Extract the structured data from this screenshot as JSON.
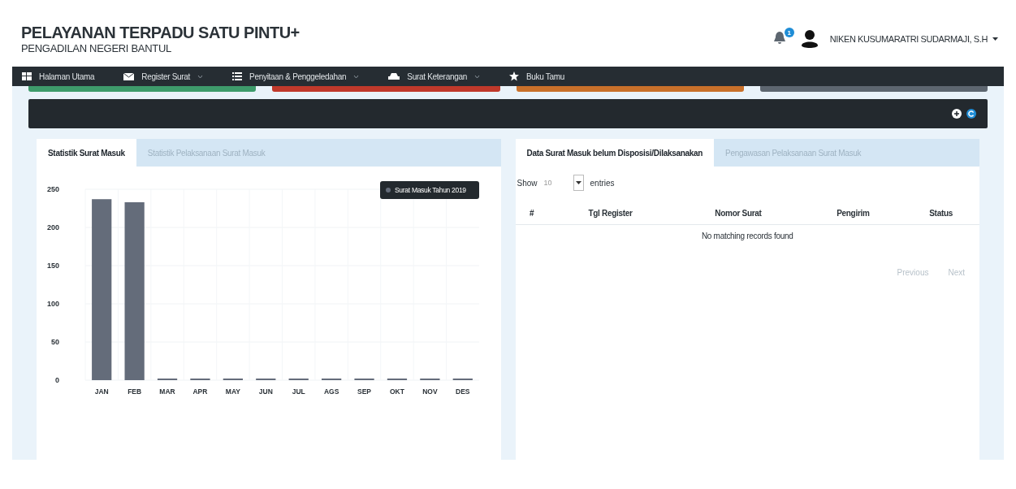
{
  "header": {
    "title": "PELAYANAN TERPADU SATU PINTU+",
    "subtitle": "PENGADILAN NEGERI BANTUL",
    "notification_count": "1",
    "user_name": "NIKEN KUSUMARATRI SUDARMAJI, S.H"
  },
  "nav": [
    {
      "label": "Halaman Utama",
      "dropdown": false
    },
    {
      "label": "Register Surat",
      "dropdown": true
    },
    {
      "label": "Penyitaan & Penggeledahan",
      "dropdown": true
    },
    {
      "label": "Surat Keterangan",
      "dropdown": true
    },
    {
      "label": "Buku Tamu",
      "dropdown": false
    }
  ],
  "stub_cards": [
    {
      "color": "#3e9b6b"
    },
    {
      "color": "#c0392b"
    },
    {
      "color": "#c9702a"
    },
    {
      "color": "#5d6670"
    }
  ],
  "left_panel": {
    "tabs": [
      {
        "label": "Statistik Surat Masuk",
        "selected": true
      },
      {
        "label": "Statistik Pelaksanaan Surat Masuk",
        "selected": false
      }
    ],
    "chart_data": {
      "type": "bar",
      "categories": [
        "JAN",
        "FEB",
        "MAR",
        "APR",
        "MAY",
        "JUN",
        "JUL",
        "AGS",
        "SEP",
        "OKT",
        "NOV",
        "DES"
      ],
      "series": [
        {
          "name": "Surat Masuk Tahun 2019",
          "color": "#646c7a",
          "values": [
            237,
            233,
            0,
            0,
            0,
            0,
            0,
            0,
            0,
            0,
            0,
            0
          ]
        }
      ],
      "ylim": [
        0,
        250
      ],
      "grid": true,
      "yticks": [
        0,
        50,
        100,
        150,
        200,
        250
      ]
    }
  },
  "right_panel": {
    "tabs": [
      {
        "label": "Data Surat Masuk belum Disposisi/Dilaksanakan",
        "selected": true
      },
      {
        "label": "Pengawasan Pelaksanaan Surat Masuk",
        "selected": false
      }
    ],
    "show_label": "Show",
    "page_size": "10",
    "entries_label": "entries",
    "columns": [
      "#",
      "Tgl Register",
      "Nomor Surat",
      "Pengirim",
      "Status"
    ],
    "empty_message": "No matching records found",
    "pagination": [
      "Previous",
      "Next"
    ]
  }
}
